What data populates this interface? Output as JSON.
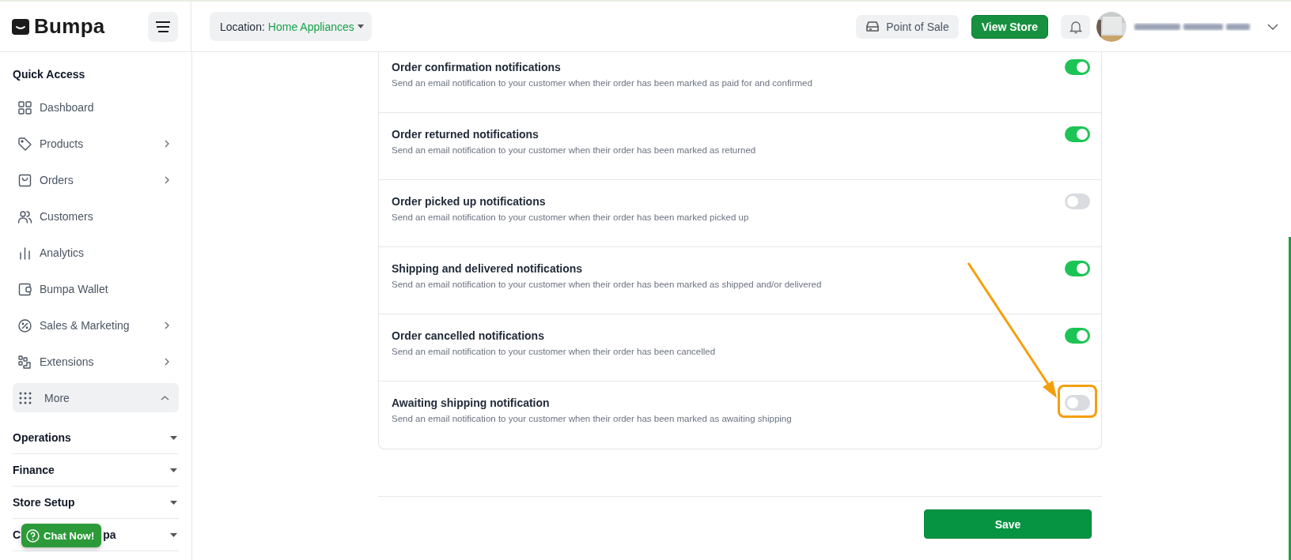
{
  "header": {
    "logo": "Bumpa",
    "location_label": "Location:",
    "location_value": "Home Appliances",
    "pos_button": "Point of Sale",
    "view_store_button": "View Store"
  },
  "sidebar": {
    "heading": "Quick Access",
    "items": [
      {
        "label": "Dashboard",
        "has_submenu": false
      },
      {
        "label": "Products",
        "has_submenu": true
      },
      {
        "label": "Orders",
        "has_submenu": true
      },
      {
        "label": "Customers",
        "has_submenu": false
      },
      {
        "label": "Analytics",
        "has_submenu": false
      },
      {
        "label": "Bumpa Wallet",
        "has_submenu": false
      },
      {
        "label": "Sales & Marketing",
        "has_submenu": true
      },
      {
        "label": "Extensions",
        "has_submenu": true
      }
    ],
    "more": {
      "label": "More",
      "expanded": true
    },
    "sections": [
      {
        "label": "Operations"
      },
      {
        "label": "Finance"
      },
      {
        "label": "Store Setup"
      },
      {
        "label_start": "C",
        "label_end": "pa"
      }
    ]
  },
  "chat_button": "Chat Now!",
  "notifications": [
    {
      "title": "Order confirmation notifications",
      "description": "Send an email notification to your customer when their order has been marked as paid for and confirmed",
      "on": true
    },
    {
      "title": "Order returned notifications",
      "description": "Send an email notification to your customer when their order has been marked as returned",
      "on": true
    },
    {
      "title": "Order picked up notifications",
      "description": "Send an email notification to your customer when their order has been marked picked up",
      "on": false
    },
    {
      "title": "Shipping and delivered notifications",
      "description": "Send an email notification to your customer when their order has been marked as shipped and/or delivered",
      "on": true
    },
    {
      "title": "Order cancelled notifications",
      "description": "Send an email notification to your customer when their order has been cancelled",
      "on": true
    },
    {
      "title": "Awaiting shipping notification",
      "description": "Send an email notification to your customer when their order has been marked as awaiting shipping",
      "on": false
    }
  ],
  "save_button": "Save"
}
